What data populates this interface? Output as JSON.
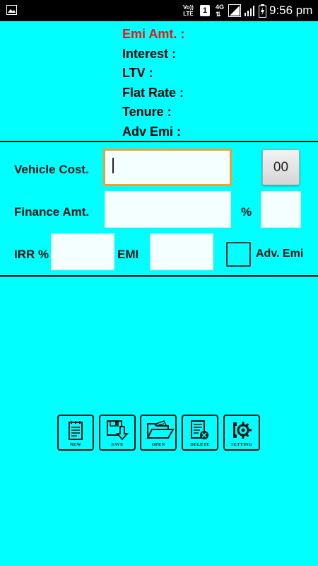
{
  "status_bar": {
    "time": "9:56 pm",
    "volte_top": "Vo))",
    "volte_bottom": "LTE",
    "sim": "1",
    "network": "4G",
    "icons": [
      "gallery-icon",
      "signal-icon",
      "battery-icon"
    ]
  },
  "summary": {
    "emi_label": "Emi Amt. :",
    "interest_label": "Interest :",
    "ltv_label": "LTV :",
    "flat_rate_label": "Flat Rate :",
    "tenure_label": "Tenure :",
    "adv_emi_label": "Adv Emi :"
  },
  "form": {
    "vehicle_cost_label": "Vehicle Cost.",
    "vehicle_cost_value": "",
    "zeros_button_label": "00",
    "finance_amt_label": "Finance Amt.",
    "finance_amt_value": "",
    "percent_label": "%",
    "percent_value": "",
    "irr_label": "IRR %",
    "irr_value": "",
    "emi_label": "EMI",
    "emi_value": "",
    "adv_emi_label": "Adv. Emi",
    "adv_emi_checked": false
  },
  "toolbar": {
    "new_label": "NEW",
    "save_label": "SAVE",
    "open_label": "OPEN",
    "delete_label": "DELETE",
    "setting_label": "SETTING"
  },
  "colors": {
    "background": "#00FFFF",
    "emi_accent": "#E01B1B",
    "focus_border": "#F0A030"
  }
}
